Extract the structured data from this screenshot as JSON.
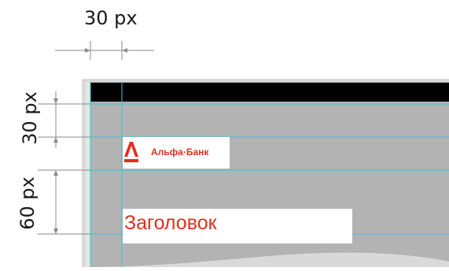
{
  "dimensions": {
    "horizontal_label": "30 px",
    "vertical_top_label": "30 px",
    "vertical_bottom_label": "60 px"
  },
  "logo": {
    "text": "Альфа·Банк",
    "letter": "А"
  },
  "heading": {
    "text": "Заголовок"
  },
  "colors": {
    "brand_red": "#e0301e",
    "guide_cyan": "#39c6d6",
    "canvas_gray": "#b3b3b3",
    "header_black": "#000000",
    "dimension_line": "#8a8a8a"
  }
}
